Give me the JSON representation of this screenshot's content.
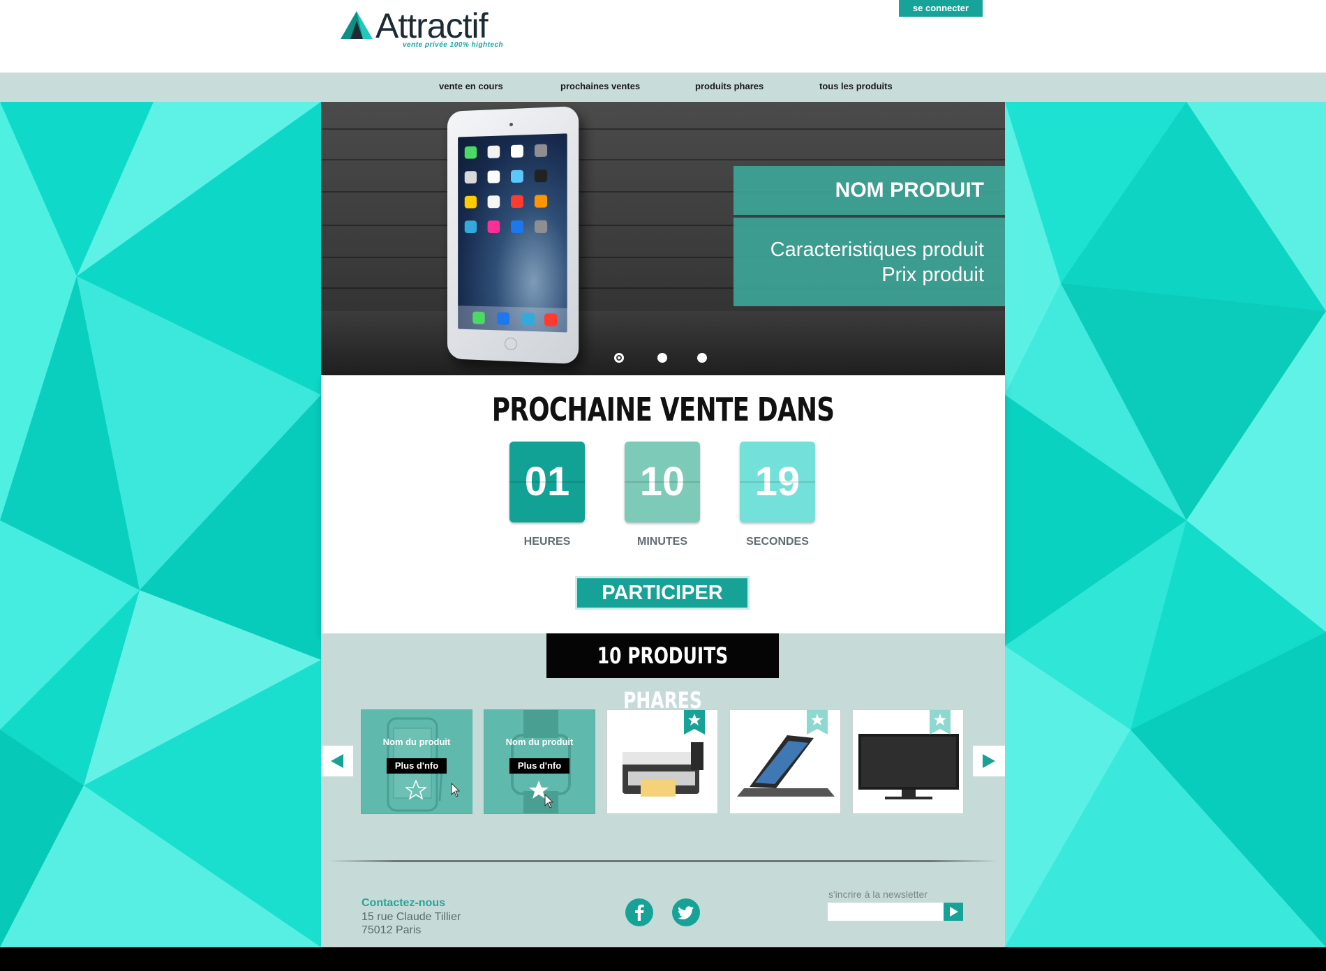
{
  "brand": {
    "name": "Attractif",
    "tagline": "vente privée 100% hightech",
    "accent": "#17a298",
    "dark": "#1c2a33"
  },
  "header": {
    "login_label": "se connecter"
  },
  "nav": {
    "items": [
      {
        "label": "vente en cours"
      },
      {
        "label": "prochaines ventes"
      },
      {
        "label": "produits phares"
      },
      {
        "label": "tous les produits"
      }
    ]
  },
  "hero": {
    "title": "NOM PRODUIT",
    "spec": "Caracteristiques produit",
    "price": "Prix produit",
    "image": "tablet",
    "slides": 3,
    "active_slide": 1
  },
  "countdown": {
    "title": "PROCHAINE VENTE DANS",
    "units": [
      {
        "value": "01",
        "label": "HEURES",
        "color": "#12a195"
      },
      {
        "value": "10",
        "label": "MINUTES",
        "color": "#7ccab7"
      },
      {
        "value": "19",
        "label": "SECONDES",
        "color": "#73e0d9"
      }
    ],
    "cta_label": "PARTICIPER"
  },
  "featured": {
    "title": "10 PRODUITS PHARES",
    "prev_icon": "arrow-left-icon",
    "next_icon": "arrow-right-icon",
    "products": [
      {
        "name": "Nom du produit",
        "more": "Plus d'nfo",
        "image": "smartphone",
        "state": "hover"
      },
      {
        "name": "Nom du produit",
        "more": "Plus d'nfo",
        "image": "smartwatch",
        "state": "hover"
      },
      {
        "image": "printer",
        "favorite": true
      },
      {
        "image": "tablet-case",
        "favorite": false
      },
      {
        "image": "television",
        "favorite": false
      }
    ]
  },
  "footer": {
    "contact_title": "Contactez-nous",
    "address_line1": "15 rue Claude Tillier",
    "address_line2": "75012 Paris",
    "social": [
      "facebook-icon",
      "twitter-icon"
    ],
    "newsletter_label": "s'incrire à la newsletter",
    "newsletter_value": ""
  }
}
